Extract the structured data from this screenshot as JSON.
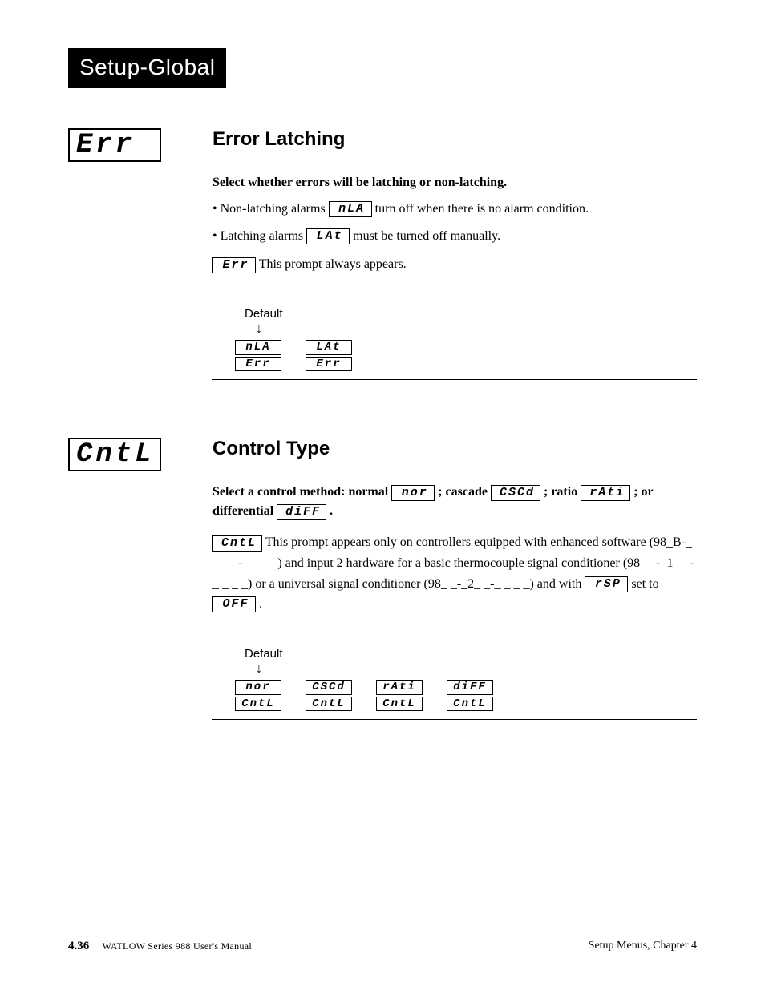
{
  "header": {
    "tab": "Setup-Global"
  },
  "section_err": {
    "display": "Err",
    "title": "Error Latching",
    "lead": "Select whether errors will be latching or non-latching.",
    "bullet1_pre": "• Non-latching alarms ",
    "bullet1_disp": "nLA",
    "bullet1_post": " turn off when there is no alarm condition.",
    "bullet2_pre": "• Latching alarms ",
    "bullet2_disp": "LAt",
    "bullet2_post": " must be turned off manually.",
    "appears_disp": "Err",
    "appears_post": " This prompt always appears.",
    "default_label": "Default",
    "arrow": "↓",
    "opts": [
      {
        "top": "nLA",
        "bot": "Err"
      },
      {
        "top": "LAt",
        "bot": "Err"
      }
    ]
  },
  "section_cntl": {
    "display": "CntL",
    "title": "Control Type",
    "lead_parts": {
      "p1": "Select a control method: normal ",
      "d1": "nor",
      "p2": "; cascade ",
      "d2": "CSCd",
      "p3": "; ratio ",
      "d3": "rAti",
      "p4": "; or differential ",
      "d4": "diFF",
      "p5": "."
    },
    "body_parts": {
      "d0": "CntL",
      "t1": " This prompt appears only on controllers equipped with enhanced software (98_B-_ _ _ _-_ _ _ _) and input 2 hardware for a basic thermocouple signal conditioner (98_ _-_1_ _-_ _ _ _) or a universal signal conditioner (98_ _-_2_ _-_ _ _ _) and with ",
      "d1": "rSP",
      "t2": " set to ",
      "d2": "OFF",
      "t3": "."
    },
    "default_label": "Default",
    "arrow": "↓",
    "opts": [
      {
        "top": "nor",
        "bot": "CntL"
      },
      {
        "top": "CSCd",
        "bot": "CntL"
      },
      {
        "top": "rAti",
        "bot": "CntL"
      },
      {
        "top": "diFF",
        "bot": "CntL"
      }
    ]
  },
  "footer": {
    "page_num": "4.36",
    "manual": "WATLOW Series 988 User's Manual",
    "chapter": "Setup Menus, Chapter 4"
  }
}
